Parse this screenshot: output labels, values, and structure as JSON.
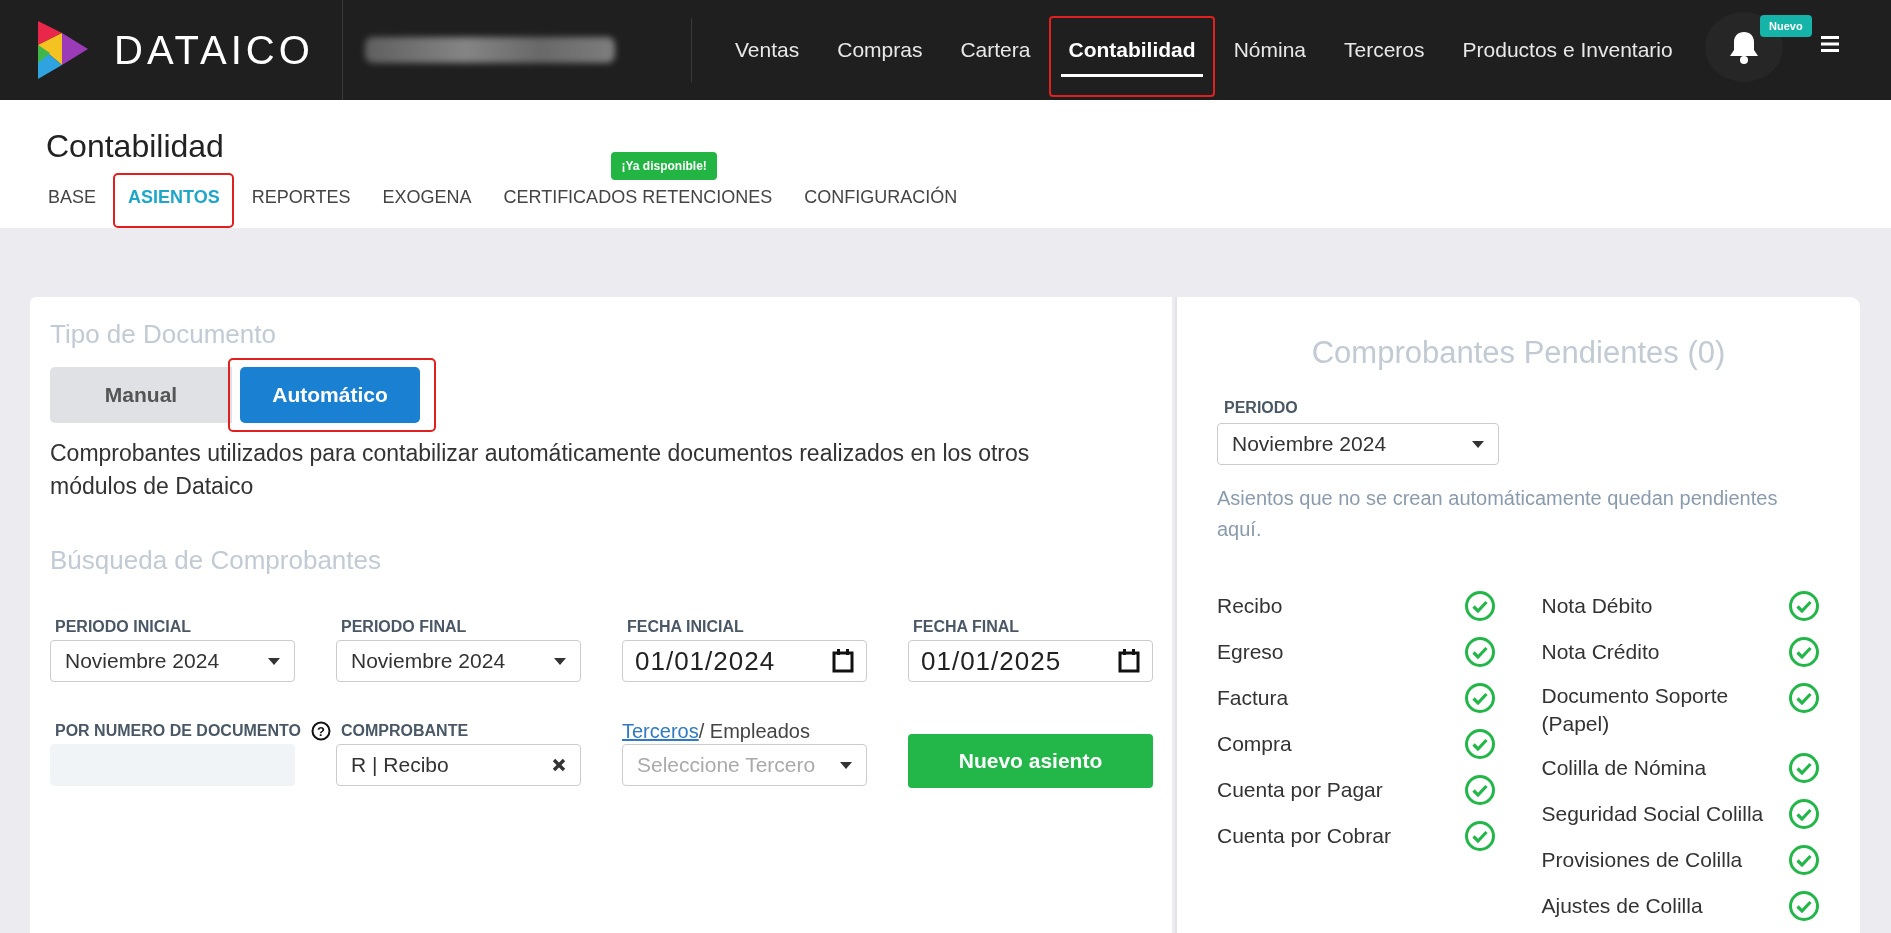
{
  "topbar": {
    "brand": "DATAICO",
    "company": {
      "kind": "blurred"
    },
    "nav": [
      {
        "label": "Ventas",
        "selected": false,
        "highlighted": false
      },
      {
        "label": "Compras",
        "selected": false,
        "highlighted": false
      },
      {
        "label": "Cartera",
        "selected": false,
        "highlighted": false
      },
      {
        "label": "Contabilidad",
        "selected": true,
        "highlighted": true
      },
      {
        "label": "Nómina",
        "selected": false,
        "highlighted": false
      },
      {
        "label": "Terceros",
        "selected": false,
        "highlighted": false
      },
      {
        "label": "Productos e Inventario",
        "selected": false,
        "highlighted": false
      }
    ],
    "notification_badge": "Nuevo"
  },
  "header": {
    "title": "Contabilidad",
    "tabs": [
      {
        "label": "BASE",
        "selected": false,
        "highlighted": false
      },
      {
        "label": "ASIENTOS",
        "selected": true,
        "highlighted": true
      },
      {
        "label": "REPORTES",
        "selected": false,
        "highlighted": false
      },
      {
        "label": "EXOGENA",
        "selected": false,
        "highlighted": false
      },
      {
        "label": "CERTIFICADOS RETENCIONES",
        "selected": false,
        "highlighted": false,
        "badge": "¡Ya disponible!"
      },
      {
        "label": "CONFIGURACIÓN",
        "selected": false,
        "highlighted": false
      }
    ]
  },
  "document_type": {
    "title": "Tipo de Documento",
    "options": [
      {
        "label": "Manual",
        "selected": false,
        "highlighted": false
      },
      {
        "label": "Automático",
        "selected": true,
        "highlighted": true
      }
    ],
    "description": "Comprobantes utilizados para contabilizar automáticamente documentos realizados en los otros módulos de Dataico"
  },
  "search": {
    "title": "Búsqueda de Comprobantes",
    "fields": [
      {
        "kind": "select",
        "label": "PERIODO INICIAL",
        "value": "Noviembre 2024"
      },
      {
        "kind": "select",
        "label": "PERIODO FINAL",
        "value": "Noviembre 2024"
      },
      {
        "kind": "date",
        "label": "FECHA INICIAL",
        "value": "01/01/2024"
      },
      {
        "kind": "date",
        "label": "FECHA FINAL",
        "value": "01/01/2025"
      },
      {
        "kind": "text",
        "label": "POR NUMERO DE DOCUMENTO",
        "help": "?"
      },
      {
        "kind": "clearable",
        "label": "COMPROBANTE",
        "value": "R | Recibo"
      },
      {
        "kind": "select",
        "label_link": "Terceros",
        "label": "/ Empleados",
        "placeholder": "Seleccione Tercero"
      },
      {
        "kind": "button",
        "label": "Nuevo asiento"
      }
    ]
  },
  "pending": {
    "title": "Comprobantes Pendientes (0)",
    "period_label": "PERIODO",
    "period": "Noviembre 2024",
    "note": "Asientos que no se crean automáticamente quedan pendientes aquí.",
    "columns": [
      [
        {
          "label": "Recibo",
          "done": true
        },
        {
          "label": "Egreso",
          "done": true
        },
        {
          "label": "Factura",
          "done": true
        },
        {
          "label": "Compra",
          "done": true
        },
        {
          "label": "Cuenta por Pagar",
          "done": true
        },
        {
          "label": "Cuenta por Cobrar",
          "done": true
        }
      ],
      [
        {
          "label": "Nota Débito",
          "done": true
        },
        {
          "label": "Nota Crédito",
          "done": true
        },
        {
          "label": "Documento Soporte (Papel)",
          "done": true
        },
        {
          "label": "Colilla de Nómina",
          "done": true
        },
        {
          "label": "Seguridad Social Colilla",
          "done": true
        },
        {
          "label": "Provisiones de Colilla",
          "done": true
        },
        {
          "label": "Ajustes de Colilla",
          "done": true
        }
      ]
    ]
  }
}
